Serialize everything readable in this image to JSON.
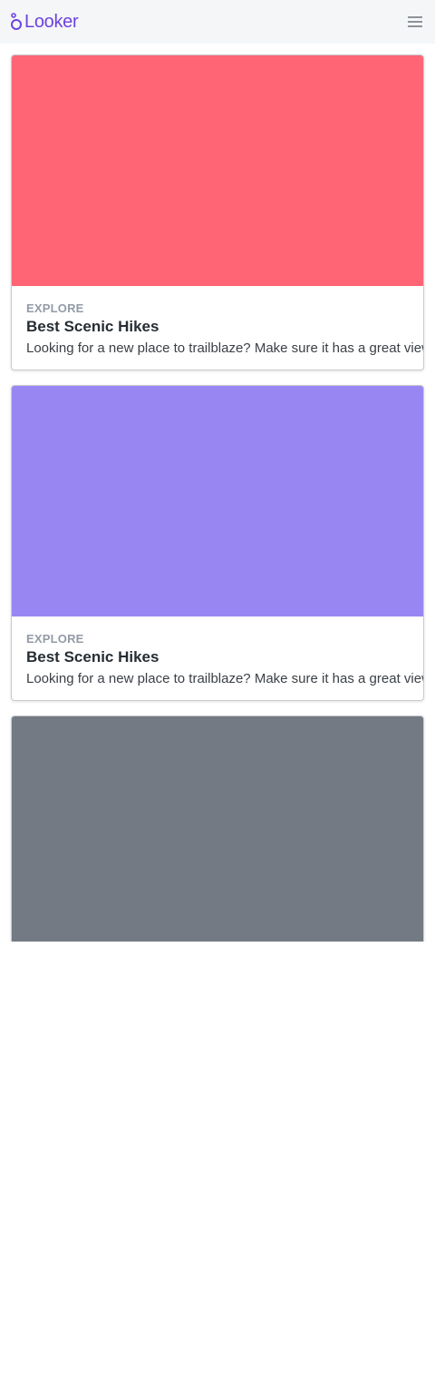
{
  "header": {
    "logo_text": "Looker",
    "menu_icon": "hamburger-menu-icon"
  },
  "colors": {
    "brand": "#6c43e0"
  },
  "cards": [
    {
      "image_color": "#ff6575",
      "eyebrow": "EXPLORE",
      "title": "Best Scenic Hikes",
      "description": "Looking for a new place to trailblaze? Make sure it has a great view!"
    },
    {
      "image_color": "#9887f2",
      "eyebrow": "EXPLORE",
      "title": "Best Scenic Hikes",
      "description": "Looking for a new place to trailblaze? Make sure it has a great view!"
    },
    {
      "image_color": "#737a84"
    }
  ]
}
